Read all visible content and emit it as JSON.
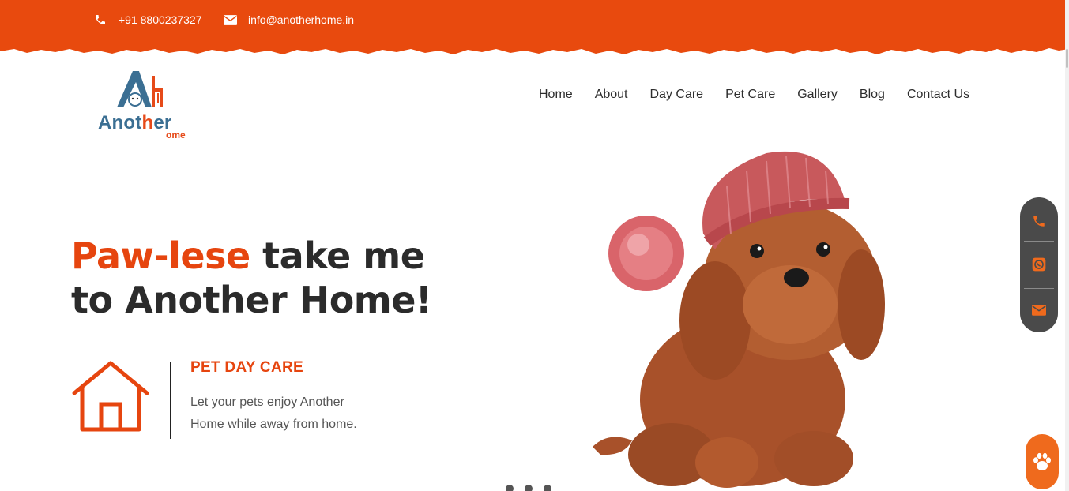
{
  "topbar": {
    "phone": "+91 8800237327",
    "email": "info@anotherhome.in",
    "phone_icon": "phone-icon",
    "email_icon": "envelope-icon",
    "background": "#e84a0e"
  },
  "logo": {
    "word_start": "Anot",
    "word_accent": "h",
    "word_end": "er",
    "sub": "ome",
    "primary_color": "#3b6f93",
    "accent_color": "#e64a19"
  },
  "nav": {
    "items": [
      "Home",
      "About",
      "Day Care",
      "Pet Care",
      "Gallery",
      "Blog",
      "Contact Us"
    ]
  },
  "hero": {
    "title_accent": "Paw-lese",
    "title_rest": " take me to Another Home!",
    "accent_color": "#e6450f",
    "feature": {
      "icon": "house-icon",
      "title": "PET DAY CARE",
      "text": "Let your pets enjoy Another Home while away from home."
    },
    "image": "puppy-in-knit-hat"
  },
  "floating": {
    "buttons": [
      "phone-icon",
      "whatsapp-icon",
      "envelope-icon"
    ],
    "paw_button": "paw-icon",
    "icon_color": "#ef6a1d"
  }
}
